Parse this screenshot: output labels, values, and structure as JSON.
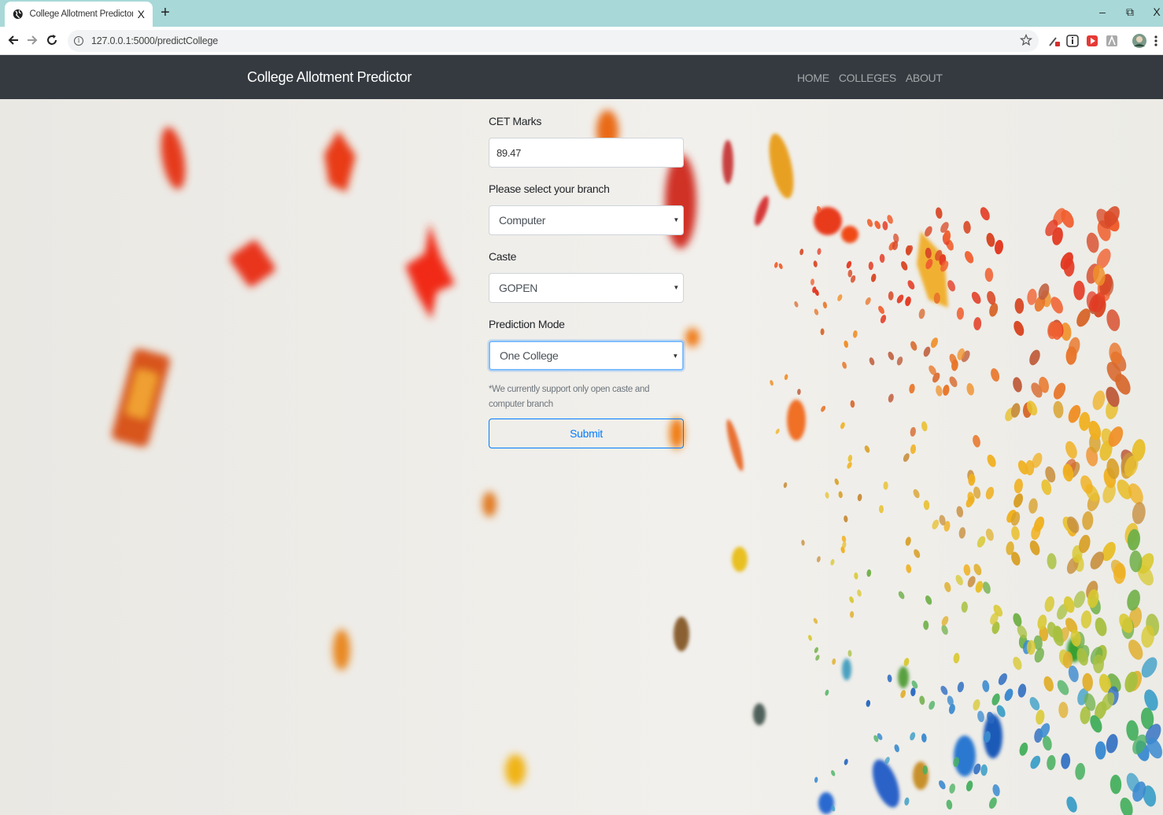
{
  "browser": {
    "tab_title": "College Allotment Predictor usin",
    "tab_close": "X",
    "new_tab": "+",
    "window_controls": {
      "minimize": "–",
      "restore": "⧉",
      "close": "X"
    },
    "url": "127.0.0.1:5000/predictCollege"
  },
  "navbar": {
    "brand": "College Allotment Predictor",
    "links": [
      "HOME",
      "COLLEGES",
      "ABOUT"
    ]
  },
  "form": {
    "cet_label": "CET Marks",
    "cet_value": "89.47",
    "branch_label": "Please select your branch",
    "branch_value": "Computer",
    "caste_label": "Caste",
    "caste_value": "GOPEN",
    "mode_label": "Prediction Mode",
    "mode_value": "One College",
    "note": "*We currently support only open caste and computer branch",
    "submit_label": "Submit"
  },
  "colors": {
    "navbar_bg": "#343a40",
    "accent": "#007bff",
    "tabstrip": "#a8d8d8"
  }
}
